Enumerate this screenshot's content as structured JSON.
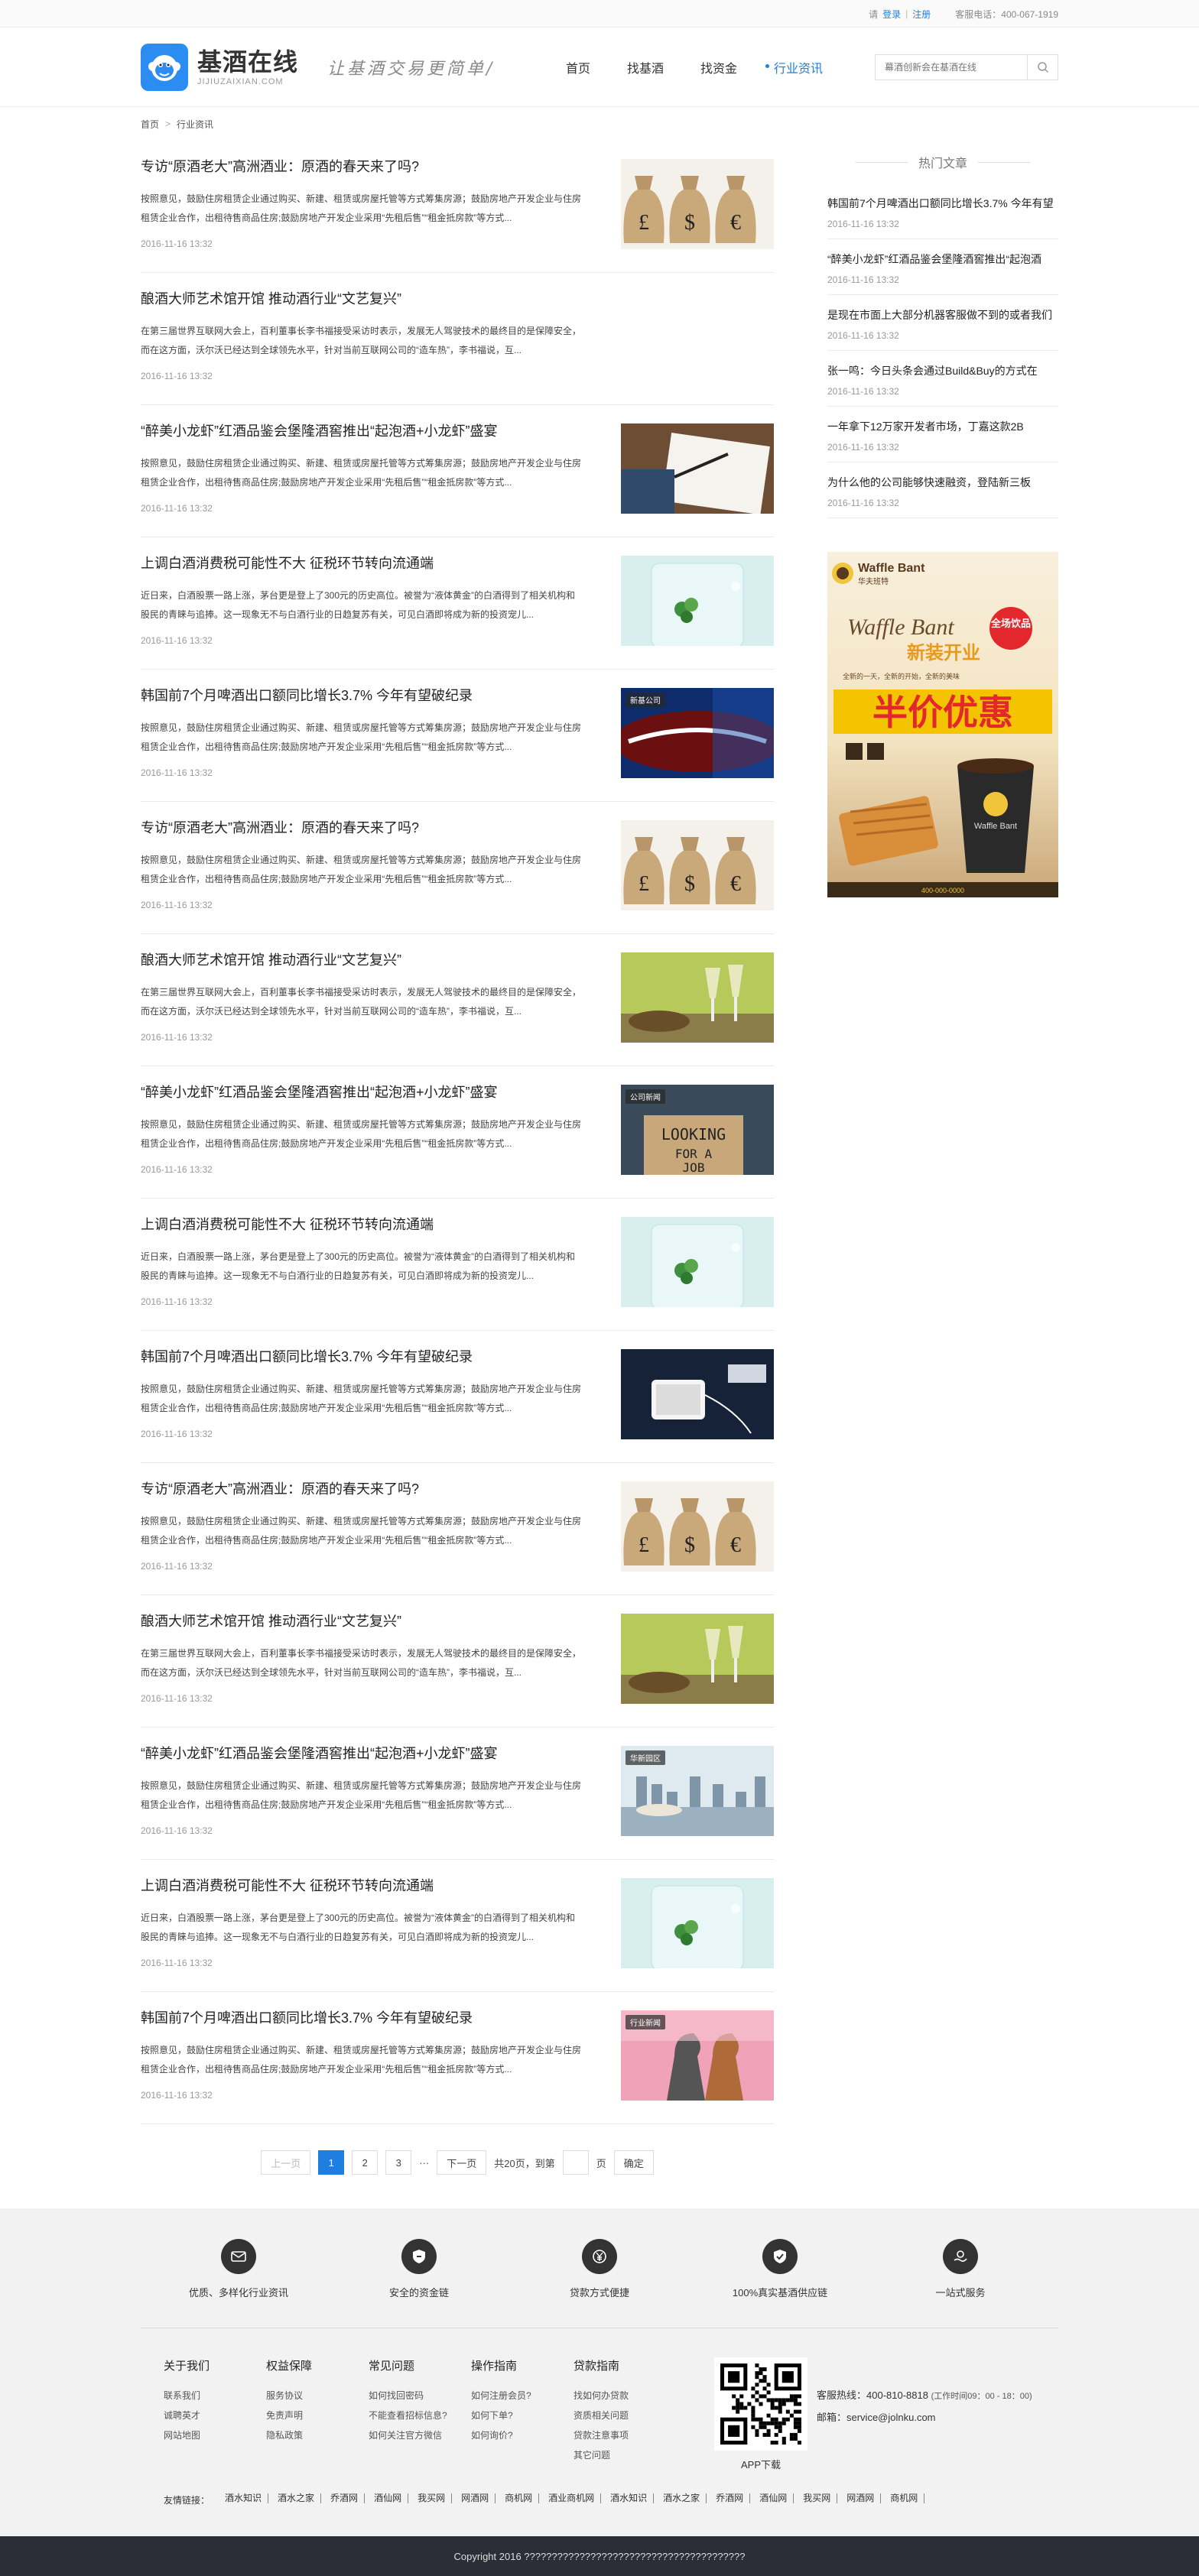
{
  "topbar": {
    "greet": "请",
    "login": "登录",
    "register": "注册",
    "phone": "客服电话：400-067-1919"
  },
  "header": {
    "logo_cn": "基酒在线",
    "logo_en": "JIJIUZAIXIAN.COM",
    "slogan": "让基酒交易更简单/",
    "nav": [
      "首页",
      "找基酒",
      "找资金",
      "行业资讯"
    ],
    "search_placeholder": "幕酒创新会在基酒在线"
  },
  "breadcrumb": {
    "home": "首页",
    "sep": ">",
    "current": "行业资讯"
  },
  "articles": [
    {
      "title": "专访“原酒老大”高洲酒业：原酒的春天来了吗?",
      "summary": "按照意见，鼓励住房租赁企业通过购买、新建、租赁或房屋托管等方式筹集房源；鼓励房地产开发企业与住房租赁企业合作，出租待售商品住房;鼓励房地产开发企业采用“先租后售”“租金抵房款”等方式...",
      "date": "2016-11-16 13:32",
      "img": "bags",
      "badge": ""
    },
    {
      "title": "酿酒大师艺术馆开馆 推动酒行业“文艺复兴”",
      "summary": "在第三届世界互联网大会上，百利董事长李书福接受采访时表示，发展无人驾驶技术的最终目的是保障安全，而在这方面，沃尔沃已经达到全球领先水平，针对当前互联网公司的“造车热”，李书福说，互...",
      "date": "2016-11-16 13:32",
      "img": "",
      "badge": ""
    },
    {
      "title": "“醉美小龙虾”红酒品鉴会堡隆酒窖推出“起泡酒+小龙虾”盛宴",
      "summary": "按照意见，鼓励住房租赁企业通过购买、新建、租赁或房屋托管等方式筹集房源；鼓励房地产开发企业与住房租赁企业合作，出租待售商品住房;鼓励房地产开发企业采用“先租后售”“租金抵房款”等方式...",
      "date": "2016-11-16 13:32",
      "img": "writing",
      "badge": ""
    },
    {
      "title": "上调白酒消费税可能性不大 征税环节转向流通端",
      "summary": "近日来，白酒股票一路上涨，茅台更是登上了300元的历史高位。被誉为“液体黄金”的白酒得到了相关机构和股民的青睐与追捧。这一现象无不与白酒行业的日趋复苏有关，可见白酒即将成为新的投资宠儿...",
      "date": "2016-11-16 13:32",
      "img": "glass",
      "badge": ""
    },
    {
      "title": "韩国前7个月啤酒出口额同比增长3.7% 今年有望破纪录",
      "summary": "按照意见，鼓励住房租赁企业通过购买、新建、租赁或房屋托管等方式筹集房源；鼓励房地产开发企业与住房租赁企业合作，出租待售商品住房;鼓励房地产开发企业采用“先租后售”“租金抵房款”等方式...",
      "date": "2016-11-16 13:32",
      "img": "cola",
      "badge": "新基公司"
    },
    {
      "title": "专访“原酒老大”高洲酒业：原酒的春天来了吗?",
      "summary": "按照意见，鼓励住房租赁企业通过购买、新建、租赁或房屋托管等方式筹集房源；鼓励房地产开发企业与住房租赁企业合作，出租待售商品住房;鼓励房地产开发企业采用“先租后售”“租金抵房款”等方式...",
      "date": "2016-11-16 13:32",
      "img": "bags",
      "badge": ""
    },
    {
      "title": "酿酒大师艺术馆开馆 推动酒行业“文艺复兴”",
      "summary": "在第三届世界互联网大会上，百利董事长李书福接受采访时表示，发展无人驾驶技术的最终目的是保障安全，而在这方面，沃尔沃已经达到全球领先水平，针对当前互联网公司的“造车热”，李书福说，互...",
      "date": "2016-11-16 13:32",
      "img": "wine",
      "badge": ""
    },
    {
      "title": "“醉美小龙虾”红酒品鉴会堡隆酒窖推出“起泡酒+小龙虾”盛宴",
      "summary": "按照意见，鼓励住房租赁企业通过购买、新建、租赁或房屋托管等方式筹集房源；鼓励房地产开发企业与住房租赁企业合作，出租待售商品住房;鼓励房地产开发企业采用“先租后售”“租金抵房款”等方式...",
      "date": "2016-11-16 13:32",
      "img": "job",
      "badge": "公司新闻"
    },
    {
      "title": "上调白酒消费税可能性不大 征税环节转向流通端",
      "summary": "近日来，白酒股票一路上涨，茅台更是登上了300元的历史高位。被誉为“液体黄金”的白酒得到了相关机构和股民的青睐与追捧。这一现象无不与白酒行业的日趋复苏有关，可见白酒即将成为新的投资宠儿...",
      "date": "2016-11-16 13:32",
      "img": "glass",
      "badge": ""
    },
    {
      "title": "韩国前7个月啤酒出口额同比增长3.7% 今年有望破纪录",
      "summary": "按照意见，鼓励住房租赁企业通过购买、新建、租赁或房屋托管等方式筹集房源；鼓励房地产开发企业与住房租赁企业合作，出租待售商品住房;鼓励房地产开发企业采用“先租后售”“租金抵房款”等方式...",
      "date": "2016-11-16 13:32",
      "img": "phone",
      "badge": ""
    },
    {
      "title": "专访“原酒老大”高洲酒业：原酒的春天来了吗?",
      "summary": "按照意见，鼓励住房租赁企业通过购买、新建、租赁或房屋托管等方式筹集房源；鼓励房地产开发企业与住房租赁企业合作，出租待售商品住房;鼓励房地产开发企业采用“先租后售”“租金抵房款”等方式...",
      "date": "2016-11-16 13:32",
      "img": "bags",
      "badge": ""
    },
    {
      "title": "酿酒大师艺术馆开馆 推动酒行业“文艺复兴”",
      "summary": "在第三届世界互联网大会上，百利董事长李书福接受采访时表示，发展无人驾驶技术的最终目的是保障安全，而在这方面，沃尔沃已经达到全球领先水平，针对当前互联网公司的“造车热”，李书福说，互...",
      "date": "2016-11-16 13:32",
      "img": "wine",
      "badge": ""
    },
    {
      "title": "“醉美小龙虾”红酒品鉴会堡隆酒窖推出“起泡酒+小龙虾”盛宴",
      "summary": "按照意见，鼓励住房租赁企业通过购买、新建、租赁或房屋托管等方式筹集房源；鼓励房地产开发企业与住房租赁企业合作，出租待售商品住房;鼓励房地产开发企业采用“先租后售”“租金抵房款”等方式...",
      "date": "2016-11-16 13:32",
      "img": "city",
      "badge": "华新园区"
    },
    {
      "title": "上调白酒消费税可能性不大 征税环节转向流通端",
      "summary": "近日来，白酒股票一路上涨，茅台更是登上了300元的历史高位。被誉为“液体黄金”的白酒得到了相关机构和股民的青睐与追捧。这一现象无不与白酒行业的日趋复苏有关，可见白酒即将成为新的投资宠儿...",
      "date": "2016-11-16 13:32",
      "img": "glass",
      "badge": ""
    },
    {
      "title": "韩国前7个月啤酒出口额同比增长3.7% 今年有望破纪录",
      "summary": "按照意见，鼓励住房租赁企业通过购买、新建、租赁或房屋托管等方式筹集房源；鼓励房地产开发企业与住房租赁企业合作，出租待售商品住房;鼓励房地产开发企业采用“先租后售”“租金抵房款”等方式...",
      "date": "2016-11-16 13:32",
      "img": "chess",
      "badge": "行业新闻"
    }
  ],
  "pager": {
    "prev": "上一页",
    "pages": [
      "1",
      "2",
      "3"
    ],
    "ellipsis": "···",
    "next": "下一页",
    "total": "共20页，到第",
    "unit": "页",
    "confirm": "确定"
  },
  "sidebar": {
    "title": "热门文章",
    "items": [
      {
        "title": "韩国前7个月啤酒出口额同比增长3.7% 今年有望",
        "date": "2016-11-16 13:32"
      },
      {
        "title": "“醉美小龙虾”红酒品鉴会堡隆酒窖推出“起泡酒",
        "date": "2016-11-16 13:32"
      },
      {
        "title": "是现在市面上大部分机器客服做不到的或者我们",
        "date": "2016-11-16 13:32"
      },
      {
        "title": "张一鸣：今日头条会通过Build&Buy的方式在",
        "date": "2016-11-16 13:32"
      },
      {
        "title": "一年拿下12万家开发者市场，丁嘉这款2B",
        "date": "2016-11-16 13:32"
      },
      {
        "title": "为什么他的公司能够快速融资，登陆新三板",
        "date": "2016-11-16 13:32"
      }
    ],
    "ad": {
      "brand": "Waffle Bant",
      "brand_cn": "华夫班特",
      "sub": "Waffle Bant",
      "tag": "新装开业",
      "line": "全新的一天，全新的开始，全新的美味",
      "badge": "全场饮品",
      "big": "半价优惠",
      "cup_brand": "Waffle Bant",
      "contact": "400-000-0000"
    }
  },
  "footer": {
    "services": [
      "优质、多样化行业资讯",
      "安全的资金链",
      "贷款方式便捷",
      "100%真实基酒供应链",
      "一站式服务"
    ],
    "cols": [
      {
        "title": "关于我们",
        "links": [
          "联系我们",
          "诚聘英才",
          "网站地图"
        ]
      },
      {
        "title": "权益保障",
        "links": [
          "服务协议",
          "免责声明",
          "隐私政策"
        ]
      },
      {
        "title": "常见问题",
        "links": [
          "如何找回密码",
          "不能查看招标信息?",
          "如何关注官方微信"
        ]
      },
      {
        "title": "操作指南",
        "links": [
          "如何注册会员?",
          "如何下单?",
          "如何询价?"
        ]
      },
      {
        "title": "贷款指南",
        "links": [
          "找如何办贷款",
          "资质相关问题",
          "贷款注意事项",
          "其它问题"
        ]
      }
    ],
    "app_label": "APP下载",
    "hotline_label": "客服热线：400-810-8818",
    "hotline_hours": "(工作时间09：00 - 18：00)",
    "email": "邮箱：service@jolnku.com",
    "friends_label": "友情链接：",
    "friends": [
      "酒水知识",
      "酒水之家",
      "乔酒网",
      "酒仙网",
      "我买网",
      "网酒网",
      "商机网",
      "酒业商机网",
      "酒水知识",
      "酒水之家",
      "乔酒网",
      "酒仙网",
      "我买网",
      "网酒网",
      "商机网"
    ],
    "copyright": "Copyright 2016 ????????????????????????????????????????"
  }
}
